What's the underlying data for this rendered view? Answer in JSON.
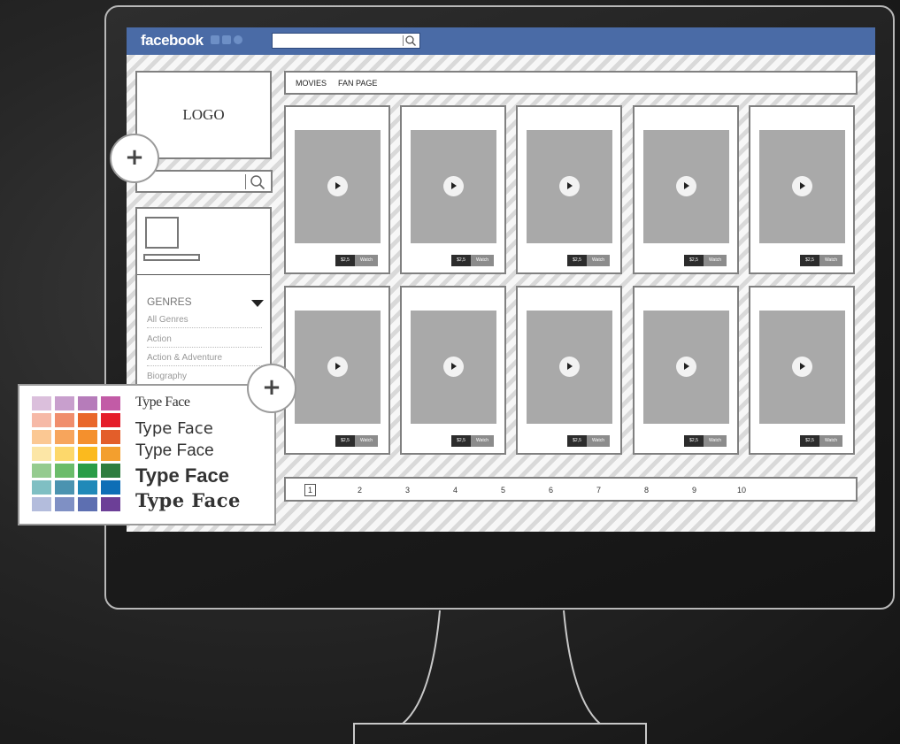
{
  "facebook": {
    "logo": "facebook",
    "icons": [
      "friends-icon",
      "messages-icon",
      "notifications-icon"
    ],
    "search_placeholder": ""
  },
  "sidebar": {
    "logo_label": "LOGO",
    "genres_title": "GENRES",
    "genres": [
      "All Genres",
      "Action",
      "Action & Adventure",
      "Biography"
    ]
  },
  "tabs": [
    "MOVIES",
    "FAN PAGE"
  ],
  "cards": [
    {
      "price": "$2,5",
      "action": "Watch"
    },
    {
      "price": "$2,5",
      "action": "Watch"
    },
    {
      "price": "$2,5",
      "action": "Watch"
    },
    {
      "price": "$2,5",
      "action": "Watch"
    },
    {
      "price": "$2,5",
      "action": "Watch"
    },
    {
      "price": "$2,5",
      "action": "Watch"
    },
    {
      "price": "$2,5",
      "action": "Watch"
    },
    {
      "price": "$2,5",
      "action": "Watch"
    },
    {
      "price": "$2,5",
      "action": "Watch"
    },
    {
      "price": "$2,5",
      "action": "Watch"
    }
  ],
  "pagination": {
    "current": "1",
    "pages": [
      "1",
      "2",
      "3",
      "4",
      "5",
      "6",
      "7",
      "8",
      "9",
      "10"
    ]
  },
  "style_panel": {
    "type_faces": [
      "Type Face",
      "Type Face",
      "Type Face",
      "Type Face",
      "Type Face"
    ],
    "palette": [
      [
        "#dbbfdc",
        "#c89fcd",
        "#b67cba",
        "#c25ba6"
      ],
      [
        "#f6b9a7",
        "#f08e6d",
        "#e9672b",
        "#e51d2a"
      ],
      [
        "#fbc893",
        "#f7a55c",
        "#f4902d",
        "#e35e2a"
      ],
      [
        "#fce6a6",
        "#fdd86b",
        "#fbba1e",
        "#f39f2e"
      ],
      [
        "#95cb8f",
        "#6bbc6a",
        "#2a9d48",
        "#2e7d3f"
      ],
      [
        "#7fbfc3",
        "#4b93b0",
        "#2089b8",
        "#0e6eb6"
      ],
      [
        "#b3bcdc",
        "#7f90c4",
        "#5d6fb1",
        "#6c3f97"
      ]
    ]
  },
  "colors": {
    "facebook_bar": "#4a6ba6",
    "media_placeholder": "#a9a9a9",
    "price_badge": "#2c2c2c",
    "watch_badge": "#8c8c8c"
  }
}
